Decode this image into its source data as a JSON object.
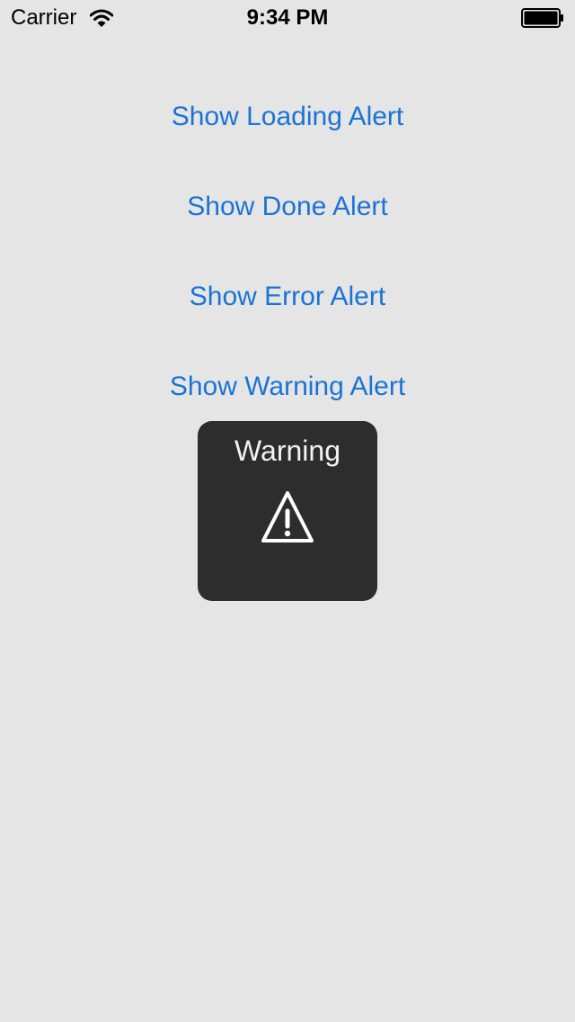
{
  "status_bar": {
    "carrier": "Carrier",
    "time": "9:34 PM",
    "wifi_icon": "wifi-icon",
    "battery_icon": "battery-full-icon",
    "battery_level": 1.0
  },
  "buttons": {
    "loading": "Show Loading Alert",
    "done": "Show Done Alert",
    "error": "Show Error Alert",
    "warning": "Show Warning Alert"
  },
  "hud": {
    "title": "Warning",
    "icon": "warning-triangle-icon"
  },
  "colors": {
    "background": "#e5e5e5",
    "button_text": "#1a74d4",
    "hud_background": "#2d2d2d",
    "hud_text": "#f2f2f2"
  }
}
